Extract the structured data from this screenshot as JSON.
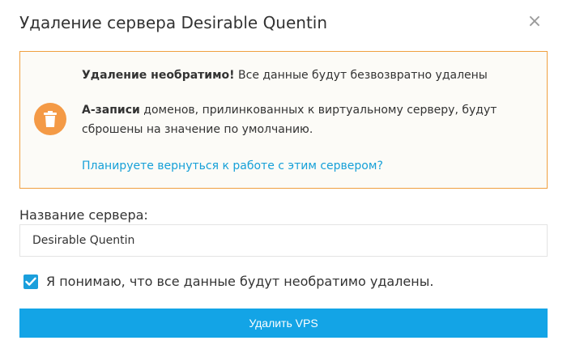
{
  "dialog": {
    "title": "Удаление сервера Desirable Quentin",
    "close_glyph": "×"
  },
  "warning": {
    "icon": "trash-icon",
    "line1_bold": "Удаление необратимо!",
    "line1_rest": " Все данные будут безвозвратно удалены",
    "line2_bold": "А-записи",
    "line2_rest": " доменов, прилинкованных к виртуальному серверу, будут сброшены на значение по умолчанию.",
    "link": "Планируете вернуться к работе с этим сервером?"
  },
  "form": {
    "server_name_label": "Название сервера:",
    "server_name_value": "Desirable Quentin",
    "confirm_checked": true,
    "confirm_label": "Я понимаю, что все данные будут необратимо удалены.",
    "submit_label": "Удалить VPS"
  },
  "colors": {
    "accent": "#13a4e6",
    "warning_border": "#f0a040",
    "warning_icon": "#f49a46",
    "link": "#16a0d8"
  }
}
